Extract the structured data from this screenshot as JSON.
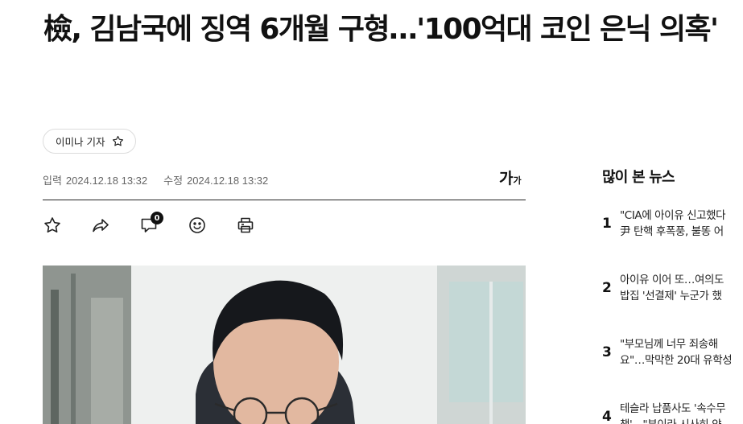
{
  "article": {
    "headline": "檢, 김남국에 징역 6개월 구형…'100억대 코인 은닉 의혹'",
    "reporter": "이미나 기자",
    "published_label": "입력",
    "published": "2024.12.18 13:32",
    "modified_label": "수정",
    "modified": "2024.12.18 13:32",
    "font_size_big": "가",
    "font_size_small": "가",
    "comment_count": "0"
  },
  "toolbar": {
    "icons": [
      "star-icon",
      "share-icon",
      "comment-icon",
      "emoji-icon",
      "print-icon"
    ]
  },
  "sidebar": {
    "title": "많이 본 뉴스",
    "items": [
      {
        "rank": "1",
        "line1": "\"CIA에 아이유 신고했다",
        "line2": "尹 탄핵 후폭풍, 불똥 어"
      },
      {
        "rank": "2",
        "line1": "아이유 이어 또…여의도",
        "line2": "밥집 '선결제' 누군가 했"
      },
      {
        "rank": "3",
        "line1": "\"부모님께 너무 죄송해",
        "line2": "요\"…막막한 20대 유학성"
      },
      {
        "rank": "4",
        "line1": "테슬라 납품사도 '속수무",
        "line2": "책'…\"부이라 시사히 얀"
      }
    ]
  },
  "colors": {
    "text": "#111111",
    "muted": "#666666",
    "border": "#dcdcdc",
    "badge_bg": "#111111"
  }
}
